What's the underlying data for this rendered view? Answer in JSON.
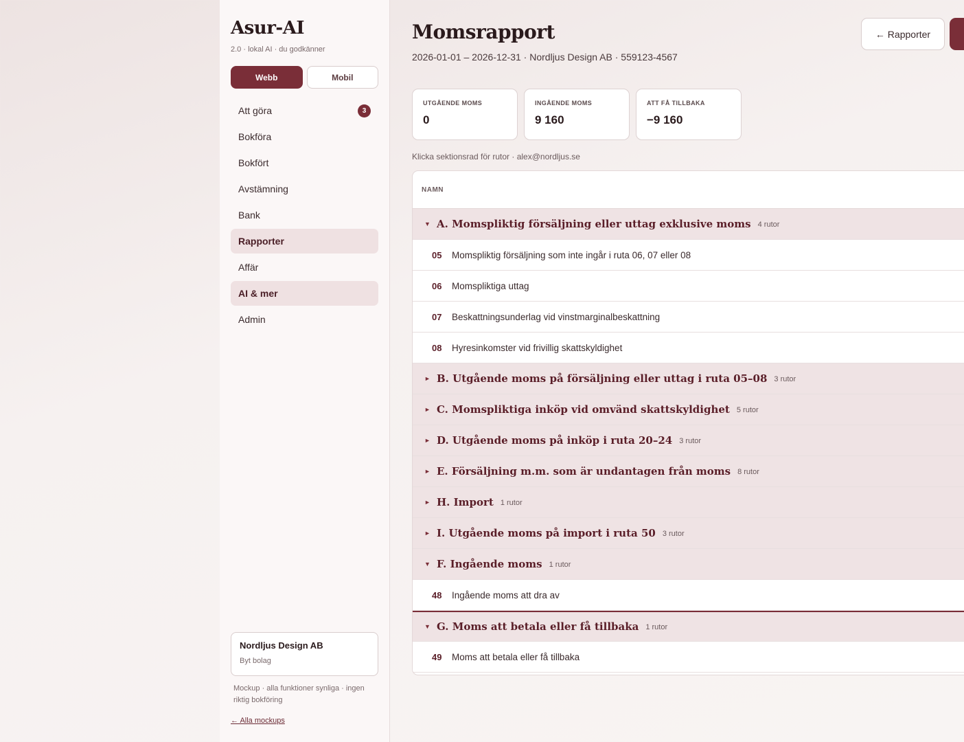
{
  "app": {
    "name": "Asur-AI",
    "subtitle": "2.0 · lokal AI · du godkänner",
    "modes": {
      "web": "Webb",
      "mobile": "Mobil"
    }
  },
  "nav": {
    "todo": {
      "label": "Att göra",
      "badge": "3"
    },
    "book": {
      "label": "Bokföra"
    },
    "booked": {
      "label": "Bokfört"
    },
    "reconcile": {
      "label": "Avstämning"
    },
    "bank": {
      "label": "Bank"
    },
    "reports": {
      "label": "Rapporter"
    },
    "business": {
      "label": "Affär"
    },
    "ai": {
      "label": "AI & mer"
    },
    "admin": {
      "label": "Admin"
    }
  },
  "company": {
    "name": "Nordljus Design AB",
    "switch_label": "Byt bolag"
  },
  "footer": {
    "note": "Mockup · alla funktioner synliga · ingen riktig bokföring",
    "link": "← Alla mockups"
  },
  "page": {
    "title": "Momsrapport",
    "subtitle": "2026-01-01 – 2026-12-31 · Nordljus Design AB · 559123-4567",
    "back_button": "← Rapporter",
    "hint": "Klicka sektionsrad för rutor · alex@nordljus.se"
  },
  "kpis": {
    "out": {
      "label": "UTGÅENDE MOMS",
      "value": "0"
    },
    "in": {
      "label": "INGÅENDE MOMS",
      "value": "9 160"
    },
    "refund": {
      "label": "ATT FÅ TILLBAKA",
      "value": "−9 160"
    }
  },
  "table": {
    "header": "NAMN",
    "sections": {
      "a": {
        "title": "A. Momspliktig försäljning eller uttag exklusive moms",
        "count": "4 rutor",
        "expanded": true
      },
      "b": {
        "title": "B. Utgående moms på försäljning eller uttag i ruta 05–08",
        "count": "3 rutor",
        "expanded": false
      },
      "c": {
        "title": "C. Momspliktiga inköp vid omvänd skattskyldighet",
        "count": "5 rutor",
        "expanded": false
      },
      "d": {
        "title": "D. Utgående moms på inköp i ruta 20–24",
        "count": "3 rutor",
        "expanded": false
      },
      "e": {
        "title": "E. Försäljning m.m. som är undantagen från moms",
        "count": "8 rutor",
        "expanded": false
      },
      "h": {
        "title": "H. Import",
        "count": "1 rutor",
        "expanded": false
      },
      "i": {
        "title": "I. Utgående moms på import i ruta 50",
        "count": "3 rutor",
        "expanded": false
      },
      "f": {
        "title": "F. Ingående moms",
        "count": "1 rutor",
        "expanded": true
      },
      "g": {
        "title": "G. Moms att betala eller få tillbaka",
        "count": "1 rutor",
        "expanded": true
      }
    },
    "boxes": {
      "b05": {
        "num": "05",
        "text": "Momspliktig försäljning som inte ingår i ruta 06, 07 eller 08"
      },
      "b06": {
        "num": "06",
        "text": "Momspliktiga uttag"
      },
      "b07": {
        "num": "07",
        "text": "Beskattningsunderlag vid vinstmarginalbeskattning"
      },
      "b08": {
        "num": "08",
        "text": "Hyresinkomster vid frivillig skattskyldighet"
      },
      "b48": {
        "num": "48",
        "text": "Ingående moms att dra av"
      },
      "b49": {
        "num": "49",
        "text": "Moms att betala eller få tillbaka"
      }
    }
  },
  "colors": {
    "accent": "#7a2e38",
    "section_bg": "#efe3e4",
    "sidebar_bg": "#fbf7f7"
  },
  "icons": {
    "expanded": "▼",
    "collapsed": "►"
  }
}
